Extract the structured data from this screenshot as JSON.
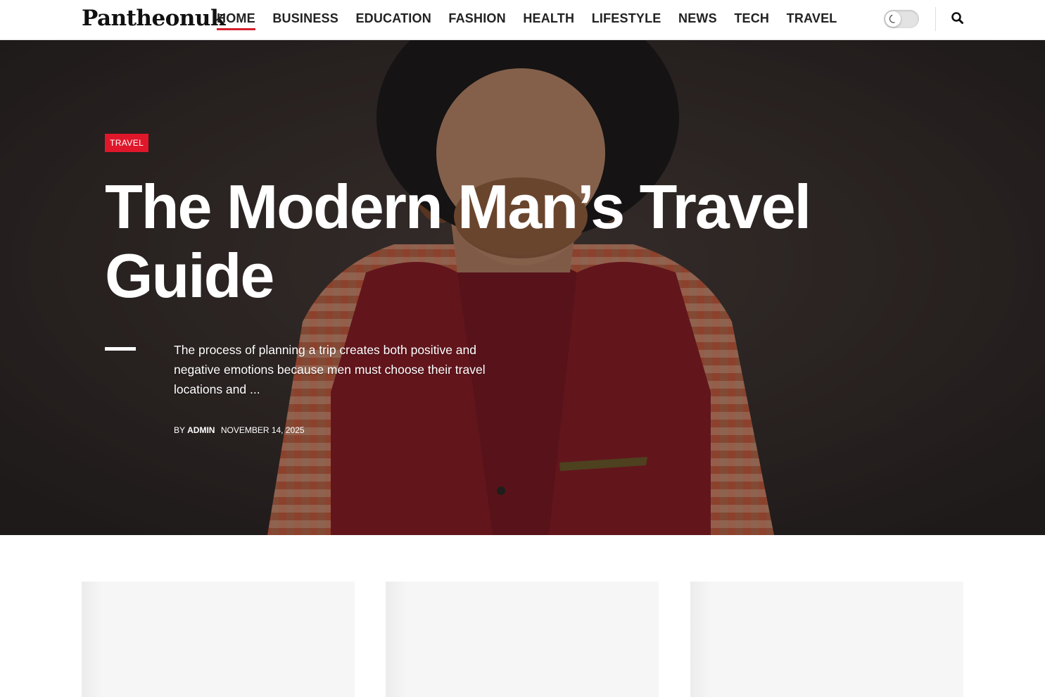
{
  "site": {
    "logo": "Pantheonuk"
  },
  "nav": {
    "items": [
      {
        "label": "HOME",
        "active": true
      },
      {
        "label": "BUSINESS"
      },
      {
        "label": "EDUCATION"
      },
      {
        "label": "FASHION"
      },
      {
        "label": "HEALTH"
      },
      {
        "label": "LIFESTYLE"
      },
      {
        "label": "NEWS"
      },
      {
        "label": "TECH"
      },
      {
        "label": "TRAVEL"
      }
    ]
  },
  "header_controls": {
    "dark_mode_toggle_icon": "moon-icon",
    "dark_mode_on": false,
    "search_icon": "search-icon"
  },
  "hero": {
    "category": "TRAVEL",
    "title": "The Modern Man’s Travel Guide",
    "excerpt": "The process of planning a trip creates both positive and negative emotions because men must choose their travel locations and ...",
    "by_label": "BY",
    "author": "ADMIN",
    "date": "NOVEMBER 14, 2025"
  },
  "colors": {
    "accent": "#e0172b",
    "nav_underline": "#d61f2c",
    "text_dark": "#222222"
  }
}
